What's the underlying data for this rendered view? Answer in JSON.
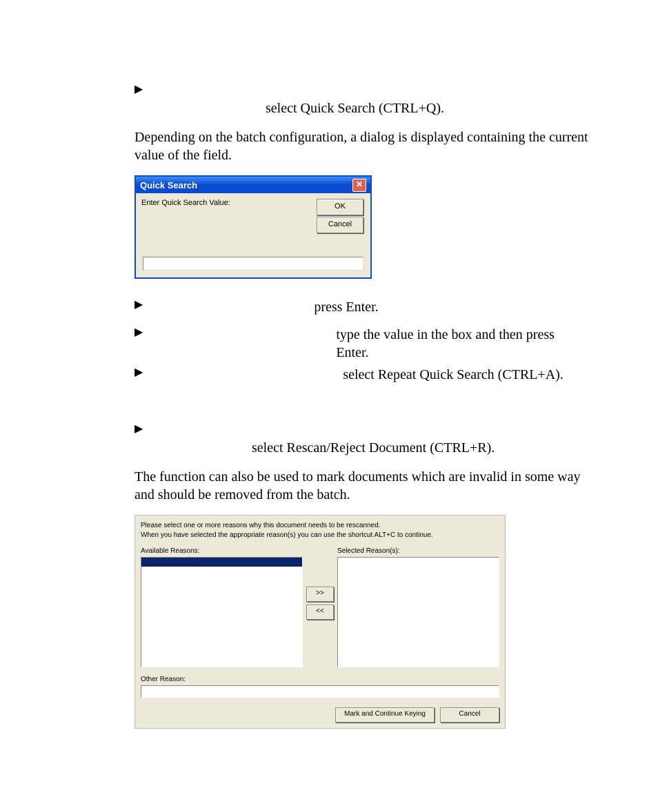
{
  "doc": {
    "bullet1_suffix": "select Quick Search (CTRL+Q).",
    "para1": "Depending on the batch configuration, a dialog is displayed containing the current value of the field.",
    "bullet2_suffix": "press Enter.",
    "bullet3_suffix": "type the value in the box and then press Enter.",
    "bullet4_suffix": "select Repeat Quick Search (CTRL+A).",
    "bullet5_suffix": "select Rescan/Reject Document (CTRL+R).",
    "para2": "The function can also be used to mark documents which are invalid in some way and should be removed from the batch."
  },
  "quick_search": {
    "title": "Quick Search",
    "label": "Enter Quick Search Value:",
    "ok": "OK",
    "cancel": "Cancel",
    "close_glyph": "✕"
  },
  "rescan": {
    "info_line1": "Please select one or more reasons why this document needs to be rescanned.",
    "info_line2": "When you have selected the appropriate reason(s) you can use the shortcut ALT+C to continue.",
    "available_label": "Available Reasons:",
    "selected_label": "Selected Reason(s):",
    "move_right": ">>",
    "move_left": "<<",
    "other_label": "Other Reason:",
    "mark_btn": "Mark and  Continue Keying",
    "cancel_btn": "Cancel"
  },
  "glyphs": {
    "triangle": "▶"
  }
}
